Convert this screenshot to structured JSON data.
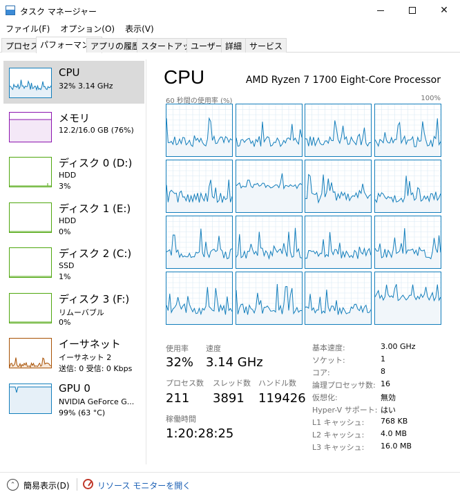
{
  "window": {
    "title": "タスク マネージャー"
  },
  "menu": [
    "ファイル(F)",
    "オプション(O)",
    "表示(V)"
  ],
  "tabs": [
    {
      "label": "プロセス",
      "active": false
    },
    {
      "label": "パフォーマンス",
      "active": true
    },
    {
      "label": "アプリの履歴",
      "active": false
    },
    {
      "label": "スタートアップ",
      "active": false
    },
    {
      "label": "ユーザー",
      "active": false
    },
    {
      "label": "詳細",
      "active": false
    },
    {
      "label": "サービス",
      "active": false
    }
  ],
  "sidebar": {
    "items": [
      {
        "title": "CPU",
        "sub1": "32%  3.14 GHz",
        "sub2": "",
        "color": "#117dbb",
        "active": true
      },
      {
        "title": "メモリ",
        "sub1": "12.2/16.0 GB (76%)",
        "sub2": "",
        "color": "#8b12ae",
        "active": false
      },
      {
        "title": "ディスク 0 (D:)",
        "sub1": "HDD",
        "sub2": "3%",
        "color": "#4da60c",
        "active": false
      },
      {
        "title": "ディスク 1 (E:)",
        "sub1": "HDD",
        "sub2": "0%",
        "color": "#4da60c",
        "active": false
      },
      {
        "title": "ディスク 2 (C:)",
        "sub1": "SSD",
        "sub2": "1%",
        "color": "#4da60c",
        "active": false
      },
      {
        "title": "ディスク 3 (F:)",
        "sub1": "リムーバブル",
        "sub2": "0%",
        "color": "#4da60c",
        "active": false
      },
      {
        "title": "イーサネット",
        "sub1": "イーサネット 2",
        "sub2": "送信: 0 受信: 0 Kbps",
        "color": "#a74f01",
        "active": false
      },
      {
        "title": "GPU 0",
        "sub1": "NVIDIA GeForce G...",
        "sub2": "99% (63 °C)",
        "color": "#117dbb",
        "active": false
      }
    ]
  },
  "main": {
    "title": "CPU",
    "cpu_name": "AMD Ryzen 7 1700 Eight-Core Processor",
    "graph_label": "60 秒間の使用率 (%)",
    "graph_max": "100%",
    "stats": {
      "usage_label": "使用率",
      "usage_value": "32%",
      "speed_label": "速度",
      "speed_value": "3.14 GHz",
      "processes_label": "プロセス数",
      "processes_value": "211",
      "threads_label": "スレッド数",
      "threads_value": "3891",
      "handles_label": "ハンドル数",
      "handles_value": "119426",
      "uptime_label": "稼働時間",
      "uptime_value": "1:20:28:25"
    },
    "specs": [
      {
        "key": "基本速度:",
        "value": "3.00 GHz"
      },
      {
        "key": "ソケット:",
        "value": "1"
      },
      {
        "key": "コア:",
        "value": "8"
      },
      {
        "key": "論理プロセッサ数:",
        "value": "16"
      },
      {
        "key": "仮想化:",
        "value": "無効"
      },
      {
        "key": "Hyper-V サポート:",
        "value": "はい"
      },
      {
        "key": "L1 キャッシュ:",
        "value": "768 KB"
      },
      {
        "key": "L2 キャッシュ:",
        "value": "4.0 MB"
      },
      {
        "key": "L3 キャッシュ:",
        "value": "16.0 MB"
      }
    ]
  },
  "footer": {
    "fewer_details": "簡易表示(D)",
    "resource_monitor": "リソース モニターを開く"
  },
  "colors": {
    "cpu_line": "#117dbb",
    "cpu_fill": "#f1f6fa",
    "grid": "#d9eaf4"
  }
}
